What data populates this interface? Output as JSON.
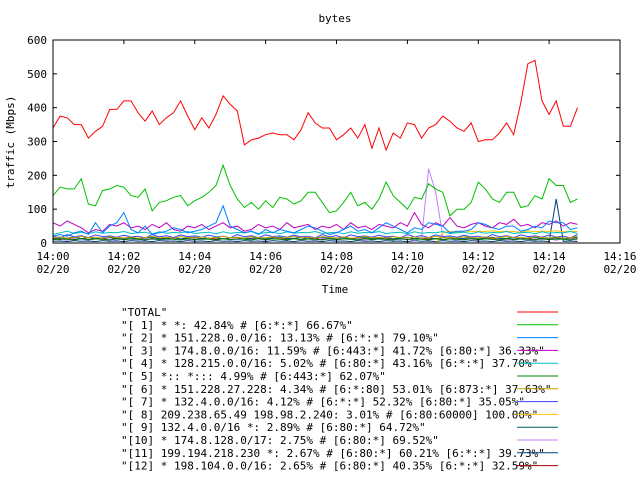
{
  "chart_data": {
    "type": "line",
    "title": "bytes",
    "xlabel": "Time",
    "ylabel": "traffic (Mbps)",
    "ylim": [
      0,
      600
    ],
    "yticks": [
      "0",
      "100",
      "200",
      "300",
      "400",
      "500",
      "600"
    ],
    "xlim": [
      "14:00",
      "14:16"
    ],
    "xticks": [
      {
        "time": "14:00",
        "date": "02/20"
      },
      {
        "time": "14:02",
        "date": "02/20"
      },
      {
        "time": "14:04",
        "date": "02/20"
      },
      {
        "time": "14:06",
        "date": "02/20"
      },
      {
        "time": "14:08",
        "date": "02/20"
      },
      {
        "time": "14:10",
        "date": "02/20"
      },
      {
        "time": "14:12",
        "date": "02/20"
      },
      {
        "time": "14:14",
        "date": "02/20"
      },
      {
        "time": "14:16",
        "date": "02/20"
      }
    ],
    "grid": false,
    "legend_position": "bottom",
    "x_minutes": [
      0,
      0.2,
      0.4,
      0.6,
      0.8,
      1,
      1.2,
      1.4,
      1.6,
      1.8,
      2,
      2.2,
      2.4,
      2.6,
      2.8,
      3,
      3.2,
      3.4,
      3.6,
      3.8,
      4,
      4.2,
      4.4,
      4.6,
      4.8,
      5,
      5.2,
      5.4,
      5.6,
      5.8,
      6,
      6.2,
      6.4,
      6.6,
      6.8,
      7,
      7.2,
      7.4,
      7.6,
      7.8,
      8,
      8.2,
      8.4,
      8.6,
      8.8,
      9,
      9.2,
      9.4,
      9.6,
      9.8,
      10,
      10.2,
      10.4,
      10.6,
      10.8,
      11,
      11.2,
      11.4,
      11.6,
      11.8,
      12,
      12.2,
      12.4,
      12.6,
      12.8,
      13,
      13.2,
      13.4,
      13.6,
      13.8,
      14,
      14.2,
      14.4,
      14.6,
      14.8,
      15
    ],
    "series": [
      {
        "name": "\"TOTAL\"",
        "color": "#ff0000",
        "values": [
          340,
          375,
          370,
          350,
          350,
          310,
          330,
          345,
          395,
          395,
          420,
          420,
          385,
          360,
          390,
          350,
          370,
          385,
          420,
          375,
          335,
          370,
          340,
          380,
          435,
          410,
          390,
          290,
          305,
          310,
          320,
          325,
          320,
          320,
          305,
          335,
          385,
          355,
          340,
          340,
          305,
          320,
          340,
          310,
          350,
          280,
          340,
          275,
          325,
          310,
          355,
          350,
          310,
          340,
          350,
          375,
          360,
          340,
          330,
          355,
          300,
          305,
          305,
          325,
          355,
          320,
          415,
          530,
          540,
          420,
          380,
          420,
          345,
          345,
          400
        ]
      },
      {
        "name": "\"[ 1] * *: 42.84% # [6:*:*] 66.67%\"",
        "color": "#00c000",
        "values": [
          140,
          165,
          160,
          160,
          190,
          115,
          110,
          155,
          160,
          170,
          165,
          140,
          135,
          160,
          95,
          120,
          125,
          135,
          140,
          110,
          125,
          135,
          150,
          170,
          230,
          170,
          130,
          105,
          120,
          100,
          125,
          105,
          135,
          130,
          115,
          125,
          150,
          150,
          120,
          90,
          95,
          120,
          150,
          110,
          120,
          100,
          130,
          180,
          140,
          120,
          100,
          135,
          130,
          175,
          160,
          150,
          80,
          100,
          100,
          120,
          180,
          160,
          130,
          120,
          150,
          150,
          105,
          110,
          140,
          130,
          190,
          170,
          170,
          120,
          130
        ]
      },
      {
        "name": "\"[ 2] * 151.228.0.0/16: 13.13% # [6:*:*] 79.10%\"",
        "color": "#0080ff",
        "values": [
          20,
          25,
          20,
          30,
          35,
          25,
          60,
          30,
          50,
          60,
          90,
          40,
          30,
          50,
          25,
          30,
          35,
          45,
          40,
          30,
          35,
          40,
          50,
          60,
          110,
          50,
          40,
          30,
          35,
          25,
          40,
          30,
          40,
          35,
          30,
          40,
          50,
          45,
          35,
          25,
          30,
          40,
          50,
          35,
          40,
          30,
          45,
          60,
          50,
          40,
          30,
          45,
          40,
          60,
          55,
          50,
          30,
          35,
          35,
          40,
          60,
          55,
          45,
          40,
          50,
          50,
          35,
          40,
          50,
          45,
          65,
          60,
          60,
          40,
          45
        ]
      },
      {
        "name": "\"[ 3] * 174.8.0.0/16: 11.59% # [6:443:*] 41.72% [6:80:*] 36.33%\"",
        "color": "#c000c0",
        "values": [
          60,
          50,
          65,
          55,
          45,
          30,
          40,
          35,
          55,
          50,
          60,
          45,
          50,
          40,
          55,
          45,
          60,
          40,
          35,
          50,
          45,
          55,
          40,
          50,
          60,
          45,
          50,
          35,
          40,
          55,
          45,
          50,
          40,
          60,
          45,
          50,
          55,
          40,
          50,
          45,
          55,
          40,
          60,
          45,
          50,
          40,
          55,
          50,
          45,
          60,
          50,
          90,
          55,
          45,
          60,
          50,
          75,
          50,
          45,
          55,
          60,
          50,
          45,
          60,
          55,
          70,
          50,
          55,
          45,
          60,
          55,
          65,
          50,
          60,
          55
        ]
      },
      {
        "name": "\"[ 4] * 128.215.0.0/16: 5.02% # [6:80:*] 43.16% [6:*:*] 37.70%\"",
        "color": "#00c0c0",
        "values": [
          25,
          30,
          35,
          28,
          32,
          27,
          33,
          29,
          31,
          30,
          34,
          28,
          30,
          32,
          27,
          33,
          29,
          31,
          30,
          34,
          28,
          30,
          32,
          27,
          33,
          29,
          31,
          30,
          34,
          28,
          30,
          32,
          27,
          33,
          29,
          31,
          30,
          34,
          28,
          30,
          32,
          27,
          33,
          29,
          31,
          30,
          34,
          28,
          30,
          32,
          27,
          33,
          29,
          31,
          30,
          34,
          28,
          30,
          32,
          27,
          33,
          29,
          31,
          30,
          34,
          28,
          30,
          32,
          27,
          33,
          29,
          31,
          30,
          34,
          28
        ]
      },
      {
        "name": "\"[ 5] *:: *::: 4.99% # [6:443:*] 62.07%\"",
        "color": "#008000",
        "values": [
          10,
          12,
          11,
          9,
          13,
          10,
          12,
          11,
          9,
          13,
          10,
          12,
          11,
          9,
          13,
          10,
          12,
          11,
          9,
          13,
          10,
          12,
          11,
          9,
          13,
          10,
          12,
          11,
          9,
          13,
          10,
          12,
          11,
          9,
          13,
          10,
          12,
          11,
          9,
          13,
          10,
          12,
          11,
          9,
          13,
          10,
          12,
          11,
          9,
          13,
          10,
          12,
          11,
          9,
          13,
          10,
          12,
          11,
          9,
          13,
          10,
          12,
          11,
          9,
          13,
          10,
          12,
          11,
          9,
          13,
          10,
          12,
          11,
          9,
          13
        ]
      },
      {
        "name": "\"[ 6] * 151.228.27.228: 4.34% # [6:*:80] 53.01% [6:873:*] 37.63%\"",
        "color": "#c0a000",
        "values": [
          15,
          18,
          14,
          16,
          20,
          15,
          17,
          14,
          19,
          16,
          15,
          18,
          14,
          16,
          20,
          15,
          17,
          14,
          19,
          16,
          15,
          18,
          14,
          16,
          20,
          15,
          17,
          14,
          19,
          16,
          15,
          18,
          14,
          16,
          20,
          15,
          17,
          14,
          19,
          16,
          15,
          18,
          14,
          16,
          20,
          15,
          17,
          14,
          19,
          16,
          15,
          18,
          14,
          16,
          20,
          15,
          17,
          14,
          19,
          16,
          15,
          18,
          14,
          16,
          20,
          15,
          17,
          14,
          19,
          16,
          15,
          18,
          14,
          16,
          20
        ]
      },
      {
        "name": "\"[ 7] * 132.4.0.0/16: 4.12% # [6:*:*] 52.32% [6:80:*] 35.05%\"",
        "color": "#4040ff",
        "values": [
          20,
          15,
          25,
          18,
          22,
          16,
          24,
          19,
          21,
          17,
          23,
          18,
          20,
          15,
          25,
          18,
          22,
          16,
          24,
          19,
          21,
          17,
          23,
          18,
          20,
          15,
          25,
          18,
          22,
          16,
          24,
          19,
          21,
          17,
          23,
          18,
          20,
          15,
          25,
          18,
          22,
          16,
          24,
          19,
          21,
          17,
          23,
          18,
          20,
          15,
          25,
          18,
          22,
          16,
          24,
          19,
          21,
          17,
          23,
          18,
          20,
          15,
          25,
          18,
          22,
          16,
          24,
          19,
          21,
          17,
          23,
          18,
          20,
          15,
          25
        ]
      },
      {
        "name": "\"[ 8] 209.238.65.49 198.98.2.240: 3.01% # [6:80:60000] 100.00%\"",
        "color": "#ffc000",
        "values": [
          0,
          0,
          0,
          0,
          0,
          0,
          0,
          0,
          0,
          0,
          0,
          0,
          0,
          0,
          0,
          0,
          0,
          0,
          0,
          0,
          0,
          0,
          0,
          0,
          0,
          0,
          0,
          0,
          0,
          0,
          0,
          0,
          0,
          0,
          0,
          0,
          0,
          0,
          0,
          0,
          0,
          0,
          0,
          0,
          0,
          0,
          0,
          0,
          0,
          0,
          0,
          0,
          0,
          0,
          0,
          30,
          35,
          32,
          36,
          33,
          35,
          34,
          36,
          33,
          35,
          34,
          32,
          36,
          33,
          35,
          34,
          36,
          33,
          35,
          34
        ]
      },
      {
        "name": "\"[ 9] 132.4.0.0/16 *: 2.89% # [6:80:*] 64.72%\"",
        "color": "#006060",
        "values": [
          15,
          12,
          14,
          18,
          13,
          16,
          12,
          15,
          17,
          13,
          14,
          16,
          12,
          15,
          17,
          13,
          14,
          16,
          12,
          15,
          17,
          13,
          14,
          16,
          12,
          15,
          17,
          13,
          14,
          16,
          12,
          15,
          17,
          13,
          14,
          16,
          12,
          15,
          17,
          13,
          14,
          16,
          12,
          15,
          17,
          13,
          14,
          16,
          12,
          15,
          17,
          13,
          14,
          16,
          12,
          15,
          17,
          13,
          14,
          16,
          12,
          15,
          17,
          13,
          14,
          16,
          12,
          15,
          17,
          13,
          14,
          16,
          12,
          15,
          17
        ]
      },
      {
        "name": "\"[10] * 174.8.128.0/17: 2.75% # [6:80:*] 69.52%\"",
        "color": "#c080ff",
        "values": [
          10,
          12,
          8,
          14,
          11,
          9,
          13,
          10,
          12,
          8,
          14,
          11,
          9,
          13,
          10,
          12,
          8,
          14,
          11,
          9,
          13,
          10,
          12,
          8,
          14,
          11,
          9,
          13,
          10,
          12,
          8,
          14,
          11,
          9,
          13,
          10,
          12,
          8,
          14,
          11,
          9,
          13,
          10,
          12,
          8,
          14,
          11,
          9,
          13,
          10,
          12,
          8,
          14,
          220,
          150,
          20,
          12,
          8,
          14,
          11,
          9,
          13,
          10,
          12,
          8,
          14,
          11,
          9,
          13,
          10,
          12,
          8,
          14,
          11,
          9
        ]
      },
      {
        "name": "\"[11] 199.194.218.230 *: 2.67% # [6:80:*] 60.21% [6:*:*] 39.73%\"",
        "color": "#004080",
        "values": [
          5,
          6,
          4,
          7,
          5,
          6,
          4,
          7,
          5,
          6,
          4,
          7,
          5,
          6,
          4,
          7,
          5,
          6,
          4,
          7,
          5,
          6,
          4,
          7,
          5,
          6,
          4,
          7,
          5,
          6,
          4,
          7,
          5,
          6,
          4,
          7,
          5,
          6,
          4,
          7,
          5,
          6,
          4,
          7,
          5,
          6,
          4,
          7,
          5,
          6,
          4,
          7,
          5,
          6,
          4,
          7,
          5,
          6,
          4,
          7,
          5,
          6,
          4,
          7,
          5,
          6,
          4,
          7,
          5,
          6,
          4,
          130,
          5,
          6,
          4
        ]
      },
      {
        "name": "\"[12] * 198.104.0.0/16: 2.65% # [6:80:*] 40.35% [6:*:*] 32.59%\"",
        "color": "#a00000",
        "values": [
          12,
          10,
          14,
          11,
          13,
          10,
          12,
          14,
          11,
          13,
          10,
          12,
          14,
          11,
          13,
          10,
          12,
          14,
          11,
          13,
          10,
          12,
          14,
          11,
          13,
          10,
          12,
          14,
          11,
          13,
          10,
          12,
          14,
          11,
          13,
          10,
          12,
          14,
          11,
          13,
          10,
          12,
          14,
          11,
          13,
          10,
          12,
          14,
          11,
          13,
          10,
          12,
          14,
          11,
          13,
          10,
          12,
          14,
          11,
          13,
          10,
          12,
          14,
          11,
          13,
          10,
          12,
          14,
          11,
          13,
          10,
          12,
          14,
          11,
          13
        ]
      }
    ]
  }
}
